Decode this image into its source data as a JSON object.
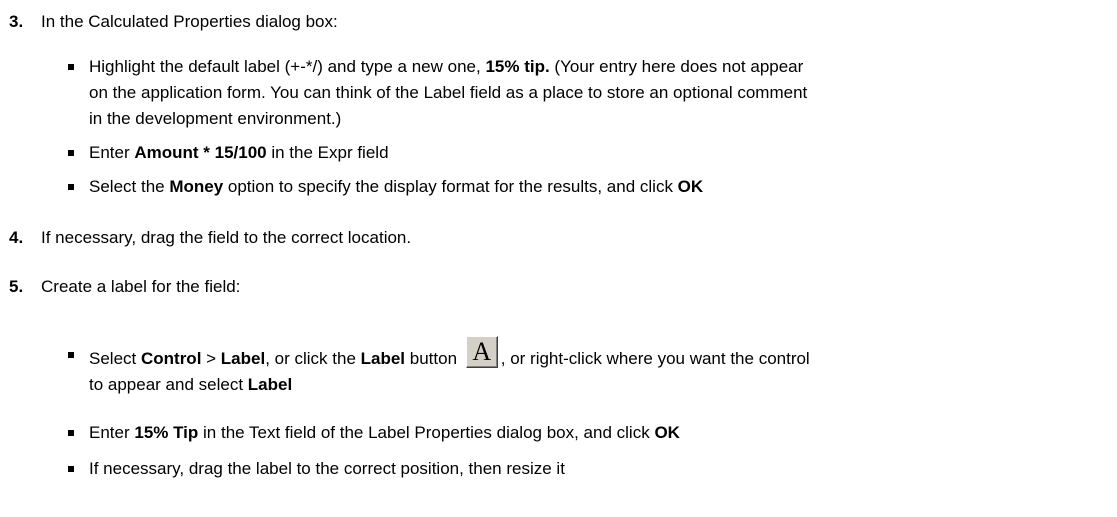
{
  "step3": {
    "number": "3.",
    "text": "In the Calculated Properties dialog box:",
    "bullets": {
      "b1": {
        "line1_a": "Highlight the default label (+-*/) and type a new one, ",
        "line1_b": "15% tip.",
        "line1_c": " (Your entry here does not appear",
        "line2": "on the application form. You can think of the Label field as a place to store an optional comment",
        "line3": "in the development environment.)"
      },
      "b2": {
        "a": "Enter ",
        "b": "Amount * 15/100",
        "c": " in the Expr field"
      },
      "b3": {
        "a": "Select the ",
        "b": "Money",
        "c": " option to specify the display format for the results, and click ",
        "d": "OK"
      }
    }
  },
  "step4": {
    "number": "4.",
    "text": "If necessary, drag the field to the correct location."
  },
  "step5": {
    "number": "5.",
    "text": "Create a label for the field:",
    "bullets": {
      "b1": {
        "a": "Select ",
        "b": "Control",
        "c": " > ",
        "d": "Label",
        "e": ", or click the ",
        "f": "Label",
        "g": " button ",
        "button_glyph": "A",
        "h": ", or right-click where you want the control",
        "line2_a": "to appear and select ",
        "line2_b": "Label"
      },
      "b2": {
        "a": "Enter ",
        "b": "15% Tip",
        "c": " in the Text field of the Label Properties dialog box, and click ",
        "d": "OK"
      },
      "b3": {
        "a": "If necessary, drag the label to the correct position, then resize it"
      }
    }
  },
  "icons": {
    "label_button_icon": "label-tool-icon"
  }
}
